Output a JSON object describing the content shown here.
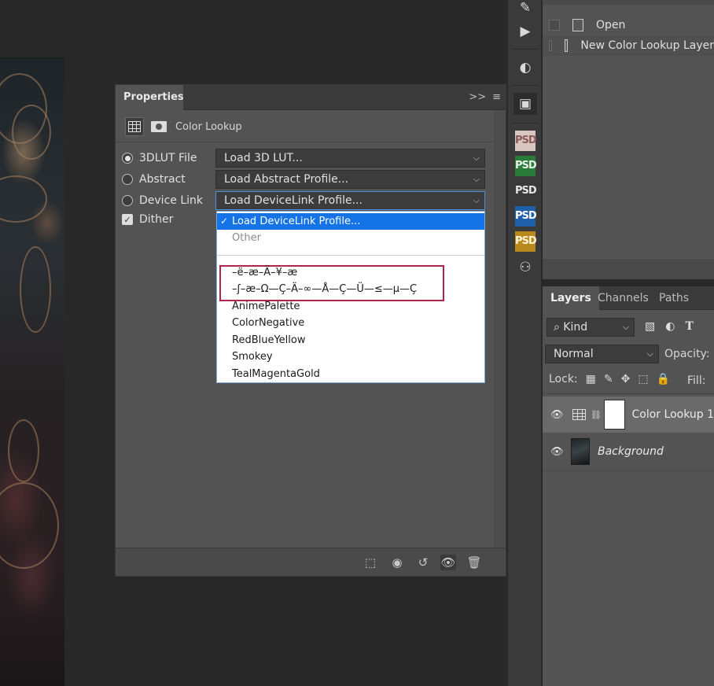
{
  "properties": {
    "tab_label": "Properties",
    "collapse_glyph": ">>",
    "menu_glyph": "≡",
    "adjustment_label": "Color Lookup",
    "options": [
      {
        "label": "3DLUT File",
        "dropdown": "Load 3D LUT..."
      },
      {
        "label": "Abstract",
        "dropdown": "Load Abstract Profile..."
      },
      {
        "label": "Device Link",
        "dropdown": "Load DeviceLink Profile..."
      }
    ],
    "dither_label": "Dither",
    "selected_option": "3DLUT File",
    "dither_checked": true
  },
  "devicelink_menu": {
    "selected": "Load DeviceLink Profile...",
    "other": "Other",
    "garbled_1": "–ë–æ–Ä–¥–æ",
    "garbled_2": "–ʃ–æ–Ω—Ç–Ä–∞—Å—Ç—Ü—≤—µ—Ç",
    "items": [
      "AnimePalette",
      "ColorNegative",
      "RedBlueYellow",
      "Smokey",
      "TealMagentaGold"
    ]
  },
  "actions": {
    "rows": [
      {
        "label": "Open"
      },
      {
        "label": "New Color Lookup Layer"
      }
    ]
  },
  "layers": {
    "tabs": [
      "Layers",
      "Channels",
      "Paths"
    ],
    "active_tab": "Layers",
    "kind_label": "Kind",
    "blend_mode": "Normal",
    "opacity_label": "Opacity:",
    "lock_label": "Lock:",
    "fill_label": "Fill:",
    "items": [
      {
        "name": "Color Lookup 1",
        "selected": true
      },
      {
        "name": "Background",
        "selected": false
      }
    ]
  },
  "toolstrip": {
    "psd_labels": [
      "PSD",
      "PSD",
      "PSD",
      "PSD",
      "PSD"
    ]
  }
}
